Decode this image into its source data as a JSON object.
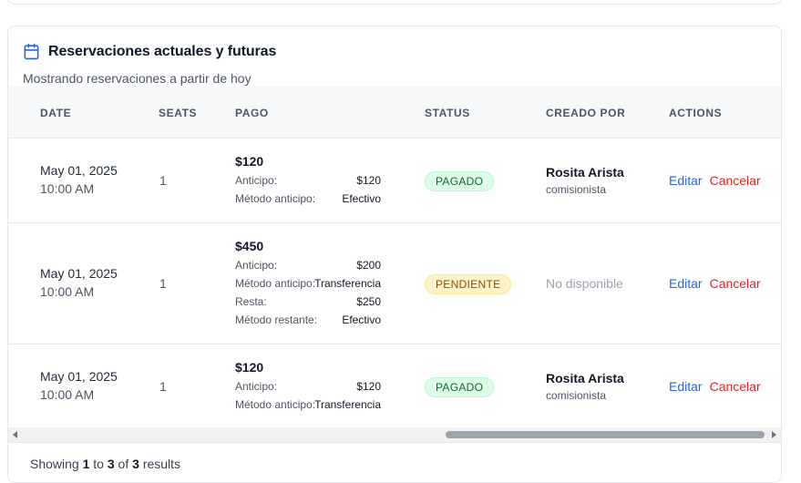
{
  "card": {
    "title": "Reservaciones actuales y futuras",
    "subtitle": "Mostrando reservaciones a partir de hoy",
    "icon": "calendar-icon",
    "accent_color": "#2563eb"
  },
  "table": {
    "headers": {
      "date": "DATE",
      "seats": "SEATS",
      "pago": "PAGO",
      "status": "STATUS",
      "creado_por": "CREADO POR",
      "actions": "ACTIONS"
    },
    "rows": [
      {
        "date": "May 01, 2025",
        "time": "10:00 AM",
        "seats": "1",
        "total": "$120",
        "payment_lines": [
          {
            "label": "Anticipo:",
            "value": "$120"
          },
          {
            "label": "Método anticipo:",
            "value": "Efectivo"
          }
        ],
        "status": "PAGADO",
        "status_color": "green",
        "creator_name": "Rosita Arista",
        "creator_role": "comisionista",
        "edit_label": "Editar",
        "cancel_label": "Cancelar"
      },
      {
        "date": "May 01, 2025",
        "time": "10:00 AM",
        "seats": "1",
        "total": "$450",
        "payment_lines": [
          {
            "label": "Anticipo:",
            "value": "$200"
          },
          {
            "label": "Método anticipo:",
            "value": "Transferencia"
          },
          {
            "label": "Resta:",
            "value": "$250"
          },
          {
            "label": "Método restante:",
            "value": "Efectivo"
          }
        ],
        "status": "PENDIENTE",
        "status_color": "yellow",
        "creator_na": "No disponible",
        "edit_label": "Editar",
        "cancel_label": "Cancelar"
      },
      {
        "date": "May 01, 2025",
        "time": "10:00 AM",
        "seats": "1",
        "total": "$120",
        "payment_lines": [
          {
            "label": "Anticipo:",
            "value": "$120"
          },
          {
            "label": "Método anticipo:",
            "value": "Transferencia"
          }
        ],
        "status": "PAGADO",
        "status_color": "green",
        "creator_name": "Rosita Arista",
        "creator_role": "comisionista",
        "edit_label": "Editar",
        "cancel_label": "Cancelar"
      }
    ]
  },
  "footer": {
    "prefix": "Showing",
    "from": "1",
    "to_word": "to",
    "to": "3",
    "of_word": "of",
    "total": "3",
    "suffix": "results"
  }
}
